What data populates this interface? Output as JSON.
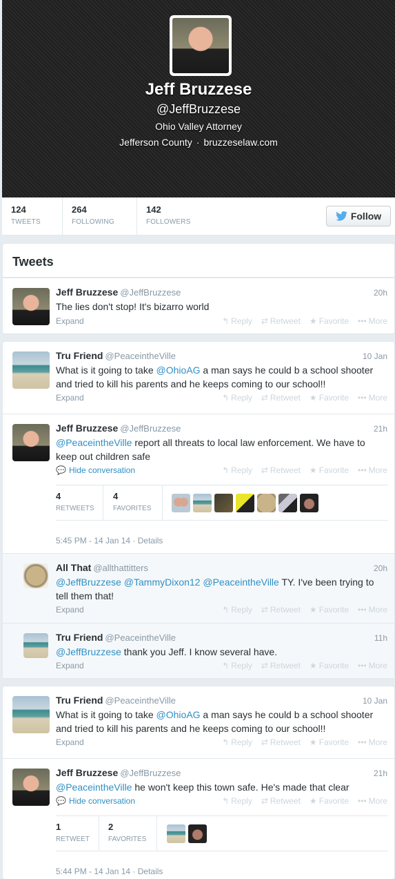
{
  "profile": {
    "name": "Jeff Bruzzese",
    "handle": "@JeffBruzzese",
    "bio": "Ohio Valley Attorney",
    "location": "Jefferson County",
    "separator": "·",
    "website": "bruzzeselaw.com"
  },
  "stats": {
    "tweets": {
      "num": "124",
      "label": "TWEETS"
    },
    "following": {
      "num": "264",
      "label": "FOLLOWING"
    },
    "followers": {
      "num": "142",
      "label": "FOLLOWERS"
    },
    "follow_label": "Follow"
  },
  "stream_title": "Tweets",
  "actions": {
    "reply": "Reply",
    "retweet": "Retweet",
    "favorite": "Favorite",
    "more": "More"
  },
  "labels": {
    "expand": "Expand",
    "hide_conversation": "Hide conversation",
    "details": "Details"
  },
  "tweets": [
    {
      "name": "Jeff Bruzzese",
      "user": "@JeffBruzzese",
      "time": "20h",
      "text": "The lies don't stop! It's bizarro world"
    },
    {
      "name": "Tru Friend",
      "user": "@PeaceintheVille",
      "time": "10 Jan",
      "pre1": "What is it going to take ",
      "m1": "@OhioAG",
      "post1": " a man says he could b a school shooter and tried to kill his parents and he keeps coming to our school!!"
    },
    {
      "name": "Jeff Bruzzese",
      "user": "@JeffBruzzese",
      "time": "21h",
      "m1": "@PeaceintheVille",
      "post1": " report all threats to local law enforcement. We have to keep out children safe",
      "retweets": "4",
      "retweets_label": "RETWEETS",
      "favorites": "4",
      "favorites_label": "FAVORITES",
      "date": "5:45 PM - 14 Jan 14 · "
    },
    {
      "name": "All That",
      "user": "@allthattitters",
      "time": "20h",
      "m1": "@JeffBruzzese",
      "m2": "@TammyDixon12",
      "m3": "@PeaceintheVille",
      "post1": " TY.  I've been trying to tell them that!"
    },
    {
      "name": "Tru Friend",
      "user": "@PeaceintheVille",
      "time": "11h",
      "m1": "@JeffBruzzese",
      "post1": " thank you Jeff. I know several have."
    },
    {
      "name": "Tru Friend",
      "user": "@PeaceintheVille",
      "time": "10 Jan",
      "pre1": "What is it going to take ",
      "m1": "@OhioAG",
      "post1": " a man says he could b a school shooter and tried to kill his parents and he keeps coming to our school!!"
    },
    {
      "name": "Jeff Bruzzese",
      "user": "@JeffBruzzese",
      "time": "21h",
      "m1": "@PeaceintheVille",
      "post1": " he won't keep this town safe. He's made that clear",
      "retweets": "1",
      "retweets_label": "RETWEET",
      "favorites": "2",
      "favorites_label": "FAVORITES",
      "date": "5:44 PM - 14 Jan 14 · "
    }
  ],
  "colors": {
    "link": "#2f8fc5",
    "muted": "#8899a6",
    "twitter_blue": "#55acee"
  }
}
